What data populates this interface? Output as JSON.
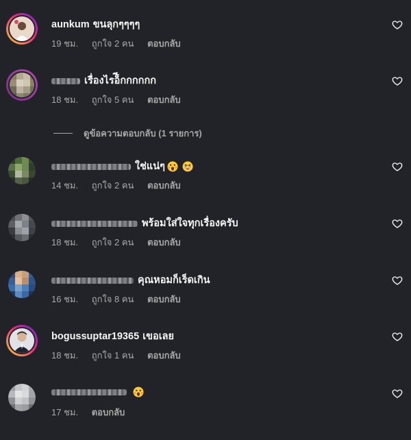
{
  "comments": [
    {
      "username": "aunkum",
      "text": "ขนลุกๆๆๆๆ",
      "time": "19 ชม.",
      "likes": "ถูกใจ 2 คน",
      "reply": "ตอบกลับ"
    },
    {
      "username": "",
      "text": "เรื่องไรอ็ีกกกกกก",
      "time": "18 ชม.",
      "likes": "ถูกใจ 5 คน",
      "reply": "ตอบกลับ",
      "view_replies": "ดูข้อความตอบกลับ (1 รายการ)"
    },
    {
      "username": "",
      "text": "ใช่แน่ๆ",
      "time": "14 ชม.",
      "likes": "ถูกใจ 2 คน",
      "reply": "ตอบกลับ"
    },
    {
      "username": "",
      "text": "พร้อมใส่ใจทุกเรื่องครับ",
      "time": "18 ชม.",
      "likes": "ถูกใจ 2 คน",
      "reply": "ตอบกลับ"
    },
    {
      "username": "",
      "text": "คุณหอมก็เร็ดเกิน",
      "time": "16 ชม.",
      "likes": "ถูกใจ 8 คน",
      "reply": "ตอบกลับ"
    },
    {
      "username": "bogussuptar19365",
      "text": "เขอเลย",
      "time": "18 ชม.",
      "likes": "ถูกใจ 1 คน",
      "reply": "ตอบกลับ"
    },
    {
      "username": "",
      "text": "",
      "time": "17 ชม.",
      "reply": "ตอบกลับ"
    }
  ],
  "icons": {
    "like": "heart-outline-icon",
    "emoji_face_screaming": "face-screaming-emoji",
    "emoji_grinning_squint": "grinning-squinting-face-emoji"
  },
  "colors": {
    "background": "#212328",
    "primary_text": "#f5f5f5",
    "secondary_text": "#a8a8a8",
    "story_ring_start": "#f9ce34",
    "story_ring_end": "#6228d7"
  }
}
